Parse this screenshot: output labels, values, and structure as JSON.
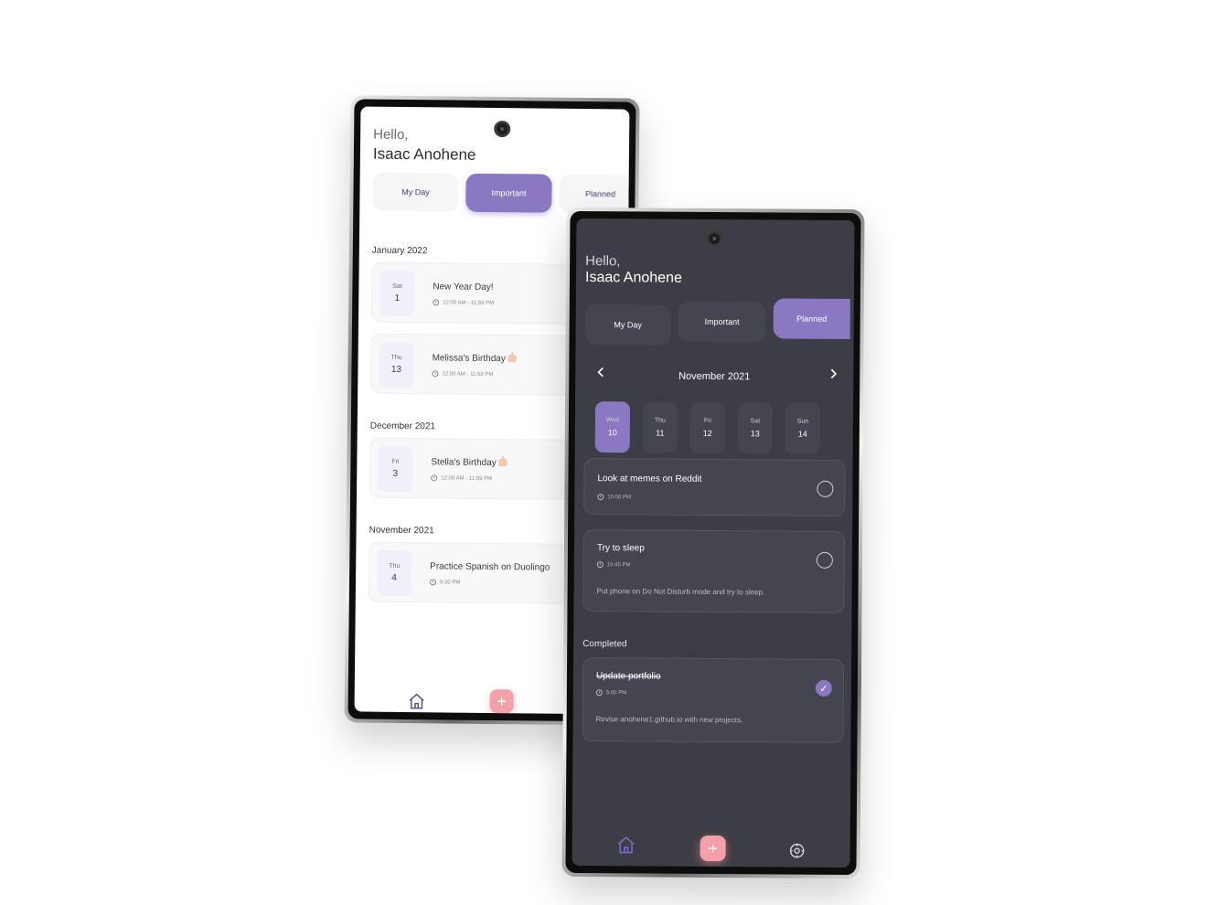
{
  "light_phone": {
    "greeting": "Hello,",
    "user_name": "Isaac Anohene",
    "tabs": [
      {
        "label": "My Day",
        "active": false
      },
      {
        "label": "Important",
        "active": true
      },
      {
        "label": "Planned",
        "active": false
      }
    ],
    "groups": [
      {
        "month": "January 2022",
        "events": [
          {
            "day": "Sat",
            "date": "1",
            "title": "New Year Day!",
            "time": "12:00 AM - 11:59 PM",
            "icon": null
          },
          {
            "day": "Thu",
            "date": "13",
            "title": "Melissa's Birthday",
            "time": "12:00 AM - 11:59 PM",
            "icon": "birthday-cake-icon"
          }
        ]
      },
      {
        "month": "December 2021",
        "events": [
          {
            "day": "Fri",
            "date": "3",
            "title": "Stella's Birthday",
            "time": "12:00 AM - 11:59 PM",
            "icon": "birthday-cake-icon"
          }
        ]
      },
      {
        "month": "November 2021",
        "events": [
          {
            "day": "Thu",
            "date": "4",
            "title": "Practice Spanish on Duolingo",
            "time": "9:30 PM",
            "icon": null
          }
        ]
      }
    ],
    "bottom_nav": {
      "home_icon": "home-icon",
      "add_label": "+"
    }
  },
  "dark_phone": {
    "greeting": "Hello,",
    "user_name": "Isaac Anohene",
    "tabs": [
      {
        "label": "My Day",
        "active": false
      },
      {
        "label": "Important",
        "active": false
      },
      {
        "label": "Planned",
        "active": true
      }
    ],
    "calendar": {
      "month": "November 2021",
      "prev_icon": "chevron-left-icon",
      "next_icon": "chevron-right-icon",
      "days": [
        {
          "day": "Wed",
          "date": "10",
          "selected": true
        },
        {
          "day": "Thu",
          "date": "11",
          "selected": false
        },
        {
          "day": "Fri",
          "date": "12",
          "selected": false
        },
        {
          "day": "Sat",
          "date": "13",
          "selected": false
        },
        {
          "day": "Sun",
          "date": "14",
          "selected": false
        }
      ]
    },
    "tasks": [
      {
        "title": "Look at memes on Reddit",
        "time": "10:00 PM",
        "note": "",
        "done": false
      },
      {
        "title": "Try to sleep",
        "time": "10:45 PM",
        "note": "Put phone on Do Not Disturb mode and try to sleep.",
        "done": false
      }
    ],
    "completed_label": "Completed",
    "completed_tasks": [
      {
        "title": "Update portfolio",
        "time": "5:00 PM",
        "note": "Revise anohene1.github.io with new projects.",
        "done": true
      }
    ],
    "bottom_nav": {
      "home_icon": "home-icon",
      "add_label": "+",
      "settings_icon": "settings-icon"
    }
  },
  "colors": {
    "accent": "#8a78c2",
    "add_button": "#f4a0a8",
    "dark_bg": "#3d3d45",
    "dark_card": "#45454f"
  }
}
